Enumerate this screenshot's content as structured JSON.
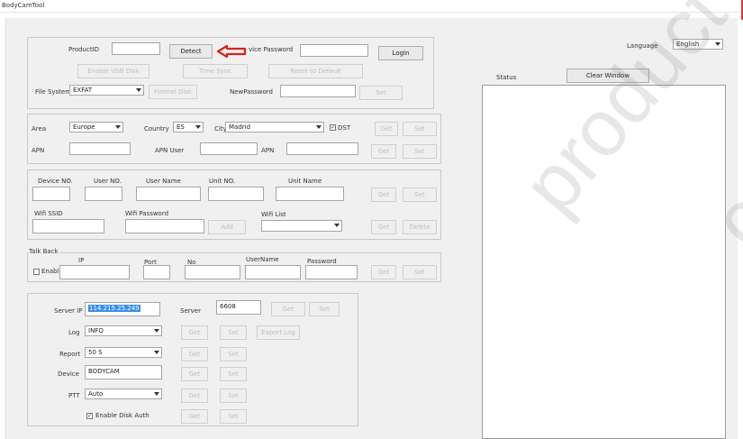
{
  "window": {
    "title": "BodyCamTool"
  },
  "product": {
    "product_id_label": "ProductID",
    "product_id_value": "",
    "detect_label": "Detect",
    "device_password_label": "vice Password",
    "device_password_value": "",
    "login_label": "Login",
    "enable_usb_disk_label": "Enable USB Disk",
    "time_sync_label": "Time Sync",
    "reset_default_label": "Reset to Default",
    "file_system_label": "File System",
    "file_system_value": "EXFAT",
    "format_disk_label": "Format Disk",
    "new_password_label": "NewPassword",
    "new_password_value": "",
    "set_label": "Set"
  },
  "region": {
    "area_label": "Area",
    "area_value": "Europe",
    "country_label": "Country",
    "country_value": "ES",
    "city_label": "City",
    "city_value": "Madrid",
    "dst_label": "DST",
    "dst_checked": true,
    "get_label": "Get",
    "set_label": "Set",
    "apn_label": "APN",
    "apn_user_label": "APN User",
    "apn2_label": "APN",
    "apn_get_label": "Get",
    "apn_set_label": "Set"
  },
  "device": {
    "device_no_label": "Device NO.",
    "user_no_label": "User NO.",
    "user_name_label": "User Name",
    "unit_no_label": "Unit NO.",
    "unit_name_label": "Unit Name",
    "get_label": "Get",
    "set_label": "Set",
    "wifi_ssid_label": "Wifi SSID",
    "wifi_password_label": "Wifi Password",
    "add_label": "Add",
    "wifi_list_label": "Wifi List",
    "wifi_get_label": "Get",
    "delete_label": "Delete"
  },
  "talkback": {
    "group_label": "Talk Back",
    "enable_label": "Enable",
    "ip_label": "IP",
    "port_label": "Port",
    "no_label": "No",
    "username_label": "UserName",
    "password_label": "Password",
    "get_label": "Get",
    "set_label": "Set"
  },
  "server": {
    "server_ip_label": "Server IP",
    "server_ip_value": "114.215.25.249",
    "server_label": "Server",
    "server_value": "6608",
    "get_label": "Get",
    "set_label": "Set",
    "log_label": "Log",
    "log_value": "INFO",
    "log_get_label": "Get",
    "log_set_label": "Set",
    "export_log_label": "Export Log",
    "report_label": "Report",
    "report_value": "50 S",
    "report_get_label": "Get",
    "report_set_label": "Set",
    "device_label": "Device",
    "device_value": "BODYCAM",
    "device_get_label": "Get",
    "device_set_label": "Set",
    "ptt_label": "PTT",
    "ptt_value": "Auto",
    "ptt_get_label": "Get",
    "ptt_set_label": "Set",
    "disk_auth_label": "Enable Disk Auth",
    "disk_auth_checked": true,
    "disk_get_label": "Get",
    "disk_set_label": "Set"
  },
  "status_panel": {
    "language_label": "Language",
    "language_value": "English",
    "status_label": "Status",
    "clear_window_label": "Clear Window"
  },
  "overlay": {
    "arrow_color": "#d9231d",
    "watermark_text": "product",
    "watermark_fragment": "c"
  }
}
